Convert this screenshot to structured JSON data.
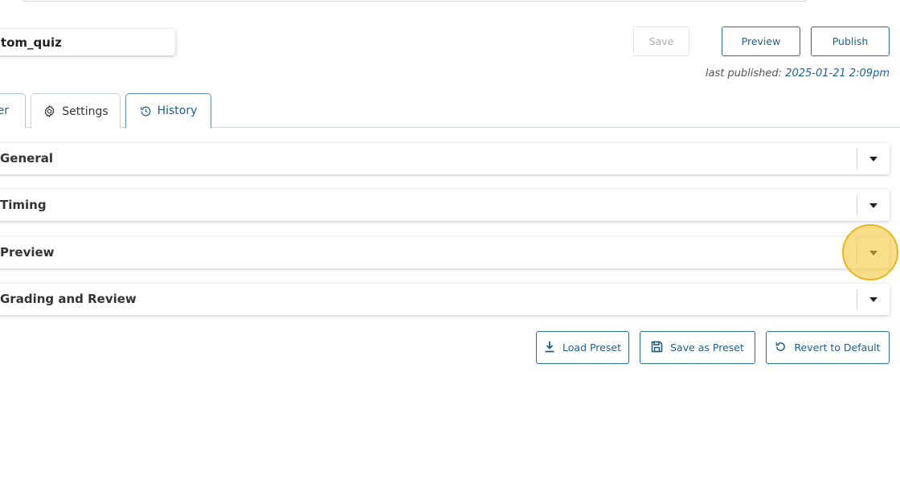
{
  "quiz": {
    "name": "stom_quiz"
  },
  "header_actions": {
    "save": "Save",
    "preview": "Preview",
    "publish": "Publish"
  },
  "publish_info": {
    "label": "last published:",
    "date": "2025-01-21 2:09pm"
  },
  "tabs": [
    {
      "label": "er",
      "icon": "none"
    },
    {
      "label": "Settings",
      "icon": "gear-icon"
    },
    {
      "label": "History",
      "icon": "history-icon"
    }
  ],
  "sections": [
    {
      "label": "General"
    },
    {
      "label": "Timing"
    },
    {
      "label": "Preview"
    },
    {
      "label": "Grading and Review"
    }
  ],
  "preset_actions": {
    "load": "Load Preset",
    "save_as": "Save as Preset",
    "revert": "Revert to Default"
  },
  "colors": {
    "accent": "#1f5f8b",
    "highlight": "#f5c83c"
  }
}
